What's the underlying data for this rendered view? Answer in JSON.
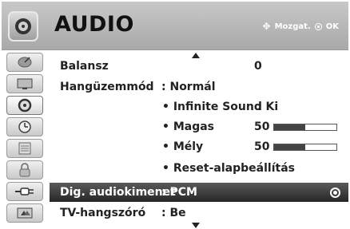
{
  "header": {
    "title": "AUDIO",
    "nav_hint": "Mozgat.",
    "ok_label": "OK"
  },
  "sidebar": {
    "items": [
      {
        "name": "satellite-dish-icon"
      },
      {
        "name": "picture-screen-icon"
      },
      {
        "name": "audio-icon",
        "active": true
      },
      {
        "name": "clock-icon"
      },
      {
        "name": "options-icon"
      },
      {
        "name": "lock-icon"
      },
      {
        "name": "input-plug-icon"
      },
      {
        "name": "usb-media-icon"
      }
    ]
  },
  "menu": {
    "balance": {
      "label": "Balansz",
      "value": "0"
    },
    "sound_mode": {
      "label": "Hangüzemmód",
      "value": ": Normál"
    },
    "infinite_sound": {
      "label": "• Infinite Sound",
      "value": ": Ki"
    },
    "treble": {
      "label": "• Magas",
      "value": "50",
      "level_percent": 50
    },
    "bass": {
      "label": "• Mély",
      "value": "50",
      "level_percent": 50
    },
    "reset": {
      "label": "• Reset-alapbeállítás"
    },
    "digital_out": {
      "label": "Dig. audiokimenet",
      "value": ": PCM"
    },
    "tv_speaker": {
      "label": "TV-hangszóró",
      "value": ": Be"
    }
  },
  "colors": {
    "header_bg": "#b4b4b4",
    "selected_row_bg": "#3a3a3a",
    "bar_fill": "#444444"
  }
}
